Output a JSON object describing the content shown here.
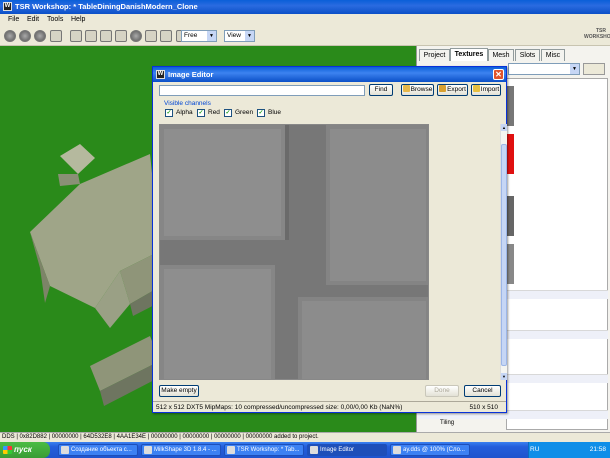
{
  "main_window": {
    "title": "TSR Workshop: * TableDiningDanishModern_Clone",
    "menu": [
      "File",
      "Edit",
      "Tools",
      "Help"
    ]
  },
  "toolbar": {
    "camera_mode": "Free",
    "view_label": "View",
    "logo_text": "TSR WORKSHOP"
  },
  "right_panel": {
    "tabs": [
      {
        "label": "Project",
        "active": false
      },
      {
        "label": "Textures",
        "active": true
      },
      {
        "label": "Mesh",
        "active": false
      },
      {
        "label": "Slots",
        "active": false
      },
      {
        "label": "Misc",
        "active": false
      }
    ],
    "param_label": "Tiling"
  },
  "status_bar": {
    "text": "DDS | 0x82D882 | 00000000 | 64D532E8 | 4AA1E34E | 00000000 | 00000000 | 00000000 | 00000000 added to project."
  },
  "taskbar": {
    "start_label": "пуск",
    "tasks": [
      {
        "label": "Создание объекта с...",
        "active": false
      },
      {
        "label": "MilkShape 3D 1.8.4 - ...",
        "active": false
      },
      {
        "label": "TSR Workshop: * Tab...",
        "active": false
      },
      {
        "label": "Image Editor",
        "active": true
      },
      {
        "label": "ay.dds @ 100% (Сло...",
        "active": false
      }
    ],
    "language": "RU",
    "clock": "21:58"
  },
  "image_editor": {
    "title": "Image Editor",
    "find_value": "",
    "buttons": {
      "find": "Find",
      "browse": "Browse",
      "export": "Export",
      "import": "Import",
      "make_empty": "Make empty",
      "done": "Done",
      "cancel": "Cancel"
    },
    "channels_label": "Visible channels",
    "channels": [
      {
        "label": "Alpha",
        "checked": true
      },
      {
        "label": "Red",
        "checked": true
      },
      {
        "label": "Green",
        "checked": true
      },
      {
        "label": "Blue",
        "checked": true
      }
    ],
    "status_info": "512 x 512 DXT5 MipMaps: 10 compressed/uncompressed size: 0,00/0,00 Kb (NaN%)",
    "status_size": "510 x 510"
  },
  "colors": {
    "viewport_bg": "#2a8a1a",
    "xp_blue": "#0a5fd8",
    "texture_gray": "#7a7a7a"
  }
}
